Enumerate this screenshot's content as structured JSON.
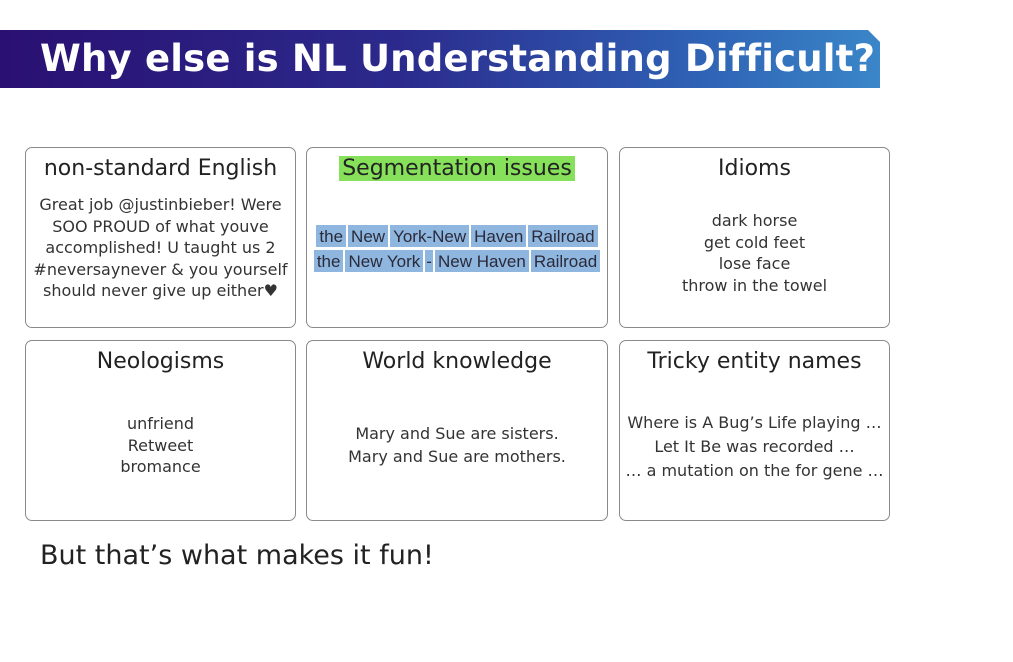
{
  "slide": {
    "title": "Why else is NL Understanding Difficult?",
    "footer": "But that’s what makes it fun!"
  },
  "cards": {
    "nonstandard": {
      "heading": "non-standard English",
      "lines": [
        "Great job @justinbieber! Were",
        "SOO PROUD of what youve",
        "accomplished! U taught us 2",
        "#neversaynever & you yourself",
        "should never give up either♥"
      ]
    },
    "segmentation": {
      "heading": "Segmentation issues",
      "row1": [
        "the",
        "New",
        "York-New",
        "Haven",
        "Railroad"
      ],
      "row2": [
        "the",
        "New York",
        "-",
        "New Haven",
        "Railroad"
      ]
    },
    "idioms": {
      "heading": "Idioms",
      "lines": [
        "dark horse",
        "get cold feet",
        "lose face",
        "throw in the towel"
      ]
    },
    "neologisms": {
      "heading": "Neologisms",
      "lines": [
        "unfriend",
        "Retweet",
        "bromance"
      ]
    },
    "world": {
      "heading": "World knowledge",
      "lines": [
        "Mary and Sue are sisters.",
        "Mary and Sue are mothers."
      ]
    },
    "tricky": {
      "heading": "Tricky entity names",
      "lines": [
        "Where is A Bug’s Life playing …",
        "Let It Be was recorded …",
        "… a mutation on the for gene …"
      ]
    }
  }
}
